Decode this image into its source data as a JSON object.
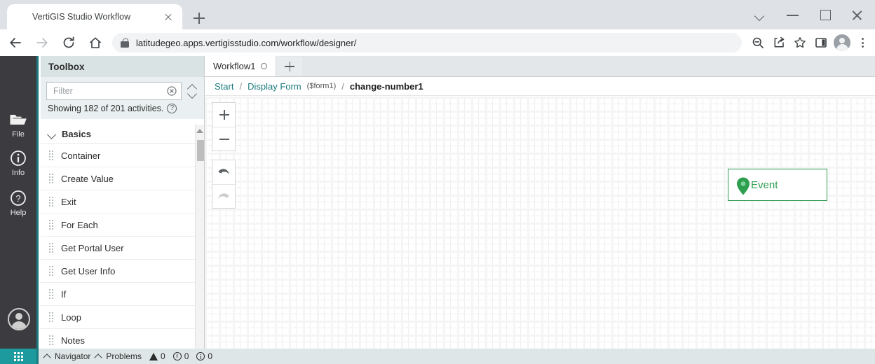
{
  "browser": {
    "tab": {
      "title": "VertiGIS Studio Workflow",
      "favicon": "vertigis-logo-icon",
      "close": "close-icon"
    },
    "new_tab": "new-tab-icon",
    "window_controls": [
      "chevron-down-icon",
      "minimize-icon",
      "maximize-icon",
      "close-icon"
    ],
    "nav": {
      "back": "back-arrow-icon",
      "forward": "forward-arrow-icon",
      "reload": "reload-icon",
      "home": "home-icon"
    },
    "address": {
      "lock": "lock-icon",
      "url": "latitudegeo.apps.vertigisstudio.com/workflow/designer/"
    },
    "toolbar_icons": [
      "zoom-out-icon",
      "share-icon",
      "bookmark-star-icon",
      "side-panel-icon",
      "profile-avatar-icon",
      "more-menu-icon"
    ]
  },
  "rail": {
    "logo": "vertigis-hex-logo-icon",
    "items": [
      {
        "label": "File",
        "icon": "folder-icon"
      },
      {
        "label": "Info",
        "icon": "info-circle-icon"
      },
      {
        "label": "Help",
        "icon": "help-circle-icon"
      }
    ],
    "avatar": "user-avatar-icon",
    "waffle": "app-grid-icon"
  },
  "toolbox": {
    "title": "Toolbox",
    "filter": {
      "value": "",
      "placeholder": "Filter",
      "clear": "clear-icon",
      "sort": "sort-chevrons-icon"
    },
    "showing": "Showing 182 of 201 activities.",
    "help": "help-circle-icon",
    "groups": [
      {
        "name": "Basics",
        "expanded": true,
        "items": [
          "Container",
          "Create Value",
          "Exit",
          "For Each",
          "Get Portal User",
          "Get User Info",
          "If",
          "Loop",
          "Notes"
        ]
      }
    ]
  },
  "editor": {
    "tabs": [
      {
        "label": "Workflow1",
        "dirty": true
      }
    ],
    "new_tab": "add-tab-icon",
    "breadcrumb": [
      {
        "text": "Start",
        "type": "link"
      },
      {
        "text": "Display Form",
        "sub": "($form1)",
        "type": "link"
      },
      {
        "text": "change-number1",
        "type": "current"
      }
    ],
    "separator": "/",
    "canvas_tools": {
      "zoom_in": "plus-icon",
      "zoom_out": "minus-icon",
      "undo": "undo-icon",
      "redo": "redo-icon"
    },
    "nodes": [
      {
        "label": "Event",
        "icon": "map-pin-icon",
        "color": "#2e9e4f"
      }
    ]
  },
  "statusbar": {
    "navigator": "Navigator",
    "problems": "Problems",
    "counts": {
      "warnings": "0",
      "errors": "0",
      "info": "0"
    }
  },
  "colors": {
    "brand_teal": "#1c7b7e",
    "rail_dark": "#3b3b40",
    "event_green": "#2e9e4f",
    "panel_header": "#d9e3e4"
  }
}
